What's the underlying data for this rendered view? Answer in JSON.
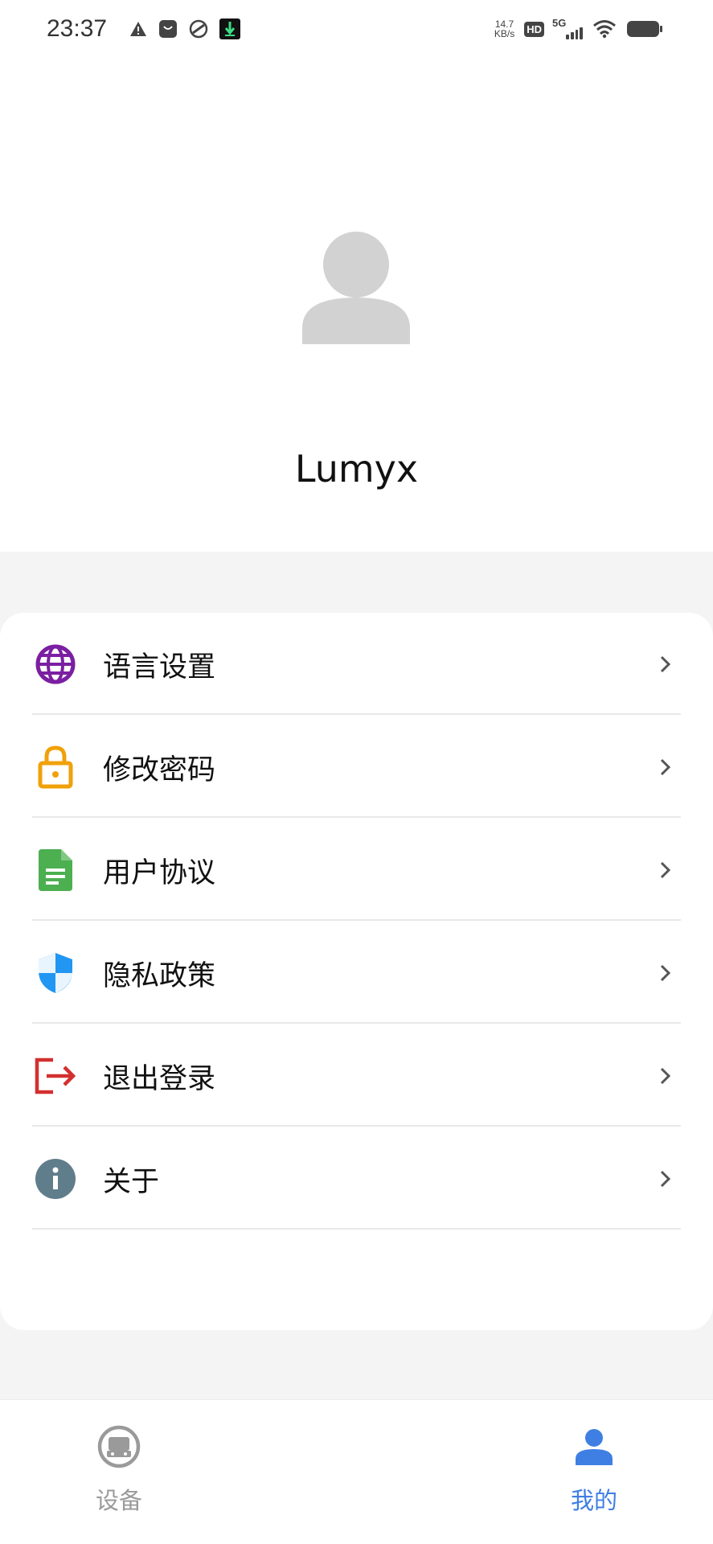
{
  "status_bar": {
    "time": "23:37",
    "net_speed_value": "14.7",
    "net_speed_unit": "KB/s",
    "hd_badge": "HD",
    "network": "5G"
  },
  "profile": {
    "username": "Lumyx"
  },
  "menu": {
    "items": [
      {
        "label": "语言设置",
        "icon": "globe-icon",
        "color": "#7b1fa2"
      },
      {
        "label": "修改密码",
        "icon": "lock-icon",
        "color": "#f0a10a"
      },
      {
        "label": "用户协议",
        "icon": "document-icon",
        "color": "#4caf50"
      },
      {
        "label": "隐私政策",
        "icon": "shield-icon",
        "color": "#2196f3"
      },
      {
        "label": "退出登录",
        "icon": "logout-icon",
        "color": "#d32f2f"
      },
      {
        "label": "关于",
        "icon": "info-icon",
        "color": "#607d8b"
      }
    ]
  },
  "tabbar": {
    "tabs": [
      {
        "label": "设备",
        "icon": "device-icon",
        "active": false
      },
      {
        "label": "我的",
        "icon": "person-icon",
        "active": true
      }
    ],
    "active_color": "#3f7fe3",
    "inactive_color": "#9a9a9a"
  }
}
